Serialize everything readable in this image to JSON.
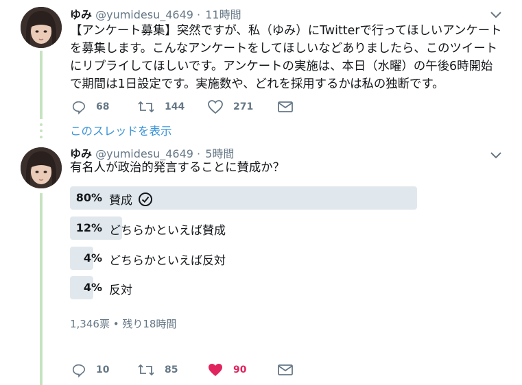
{
  "tweet1": {
    "name": "ゆみ",
    "handle": "@yumidesu_4649",
    "separator": "·",
    "time": "11時間",
    "lines": [
      "【アンケート募集】突然ですが、私（ゆみ）にTwitterで行ってほしいアンケート",
      "を募集します。こんなアンケートをしてほしいなどありましたら、このツイート",
      "にリプライしてほしいです。アンケートの実施は、本日（水曜）の午後6時開始",
      "で期間は1日設定です。実施数や、どれを採用するかは私の独断です。"
    ],
    "actions": {
      "reply": {
        "icon": "reply-icon",
        "count": "68"
      },
      "retweet": {
        "icon": "retweet-icon",
        "count": "144"
      },
      "like": {
        "icon": "heart-outline-icon",
        "count": "271"
      },
      "dm": {
        "icon": "envelope-icon"
      }
    }
  },
  "show_thread": "このスレッドを表示",
  "tweet2": {
    "name": "ゆみ",
    "handle": "@yumidesu_4649",
    "separator": "·",
    "time": "5時間",
    "question": "有名人が政治的発言することに賛成か？",
    "poll": [
      {
        "percent": "80%",
        "fraction": 0.8,
        "label": "賛成",
        "selected": true
      },
      {
        "percent": "12%",
        "fraction": 0.12,
        "label": "どちらかといえば賛成",
        "selected": false
      },
      {
        "percent": "4%",
        "fraction": 0.04,
        "label": "どちらかといえば反対",
        "selected": false
      },
      {
        "percent": "4%",
        "fraction": 0.04,
        "label": "反対",
        "selected": false
      }
    ],
    "poll_meta": "1,346票 • 残り18時間",
    "actions": {
      "reply": {
        "icon": "reply-icon",
        "count": "10"
      },
      "retweet": {
        "icon": "retweet-icon",
        "count": "85"
      },
      "like": {
        "icon": "heart-filled-icon",
        "count": "90",
        "color": "#e0245e"
      },
      "dm": {
        "icon": "envelope-icon"
      }
    }
  },
  "colors": {
    "link": "#3b94d9",
    "muted": "#657786",
    "thread_line": "#c5e3c0",
    "poll_bar": "#e1e8ed",
    "like_active": "#e0245e"
  }
}
